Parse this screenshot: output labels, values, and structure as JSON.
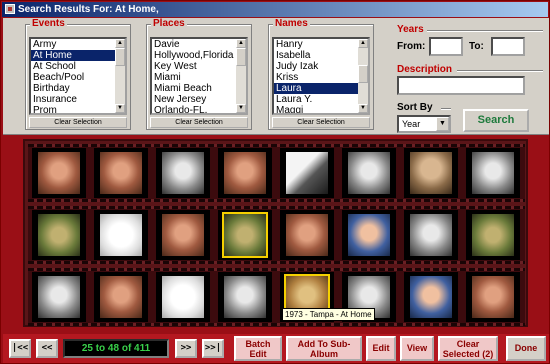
{
  "window": {
    "title": "Search Results For: At Home,"
  },
  "events": {
    "label": "Events",
    "items": [
      "Army",
      "At Home",
      "At School",
      "Beach/Pool",
      "Birthday",
      "Insurance",
      "Prom"
    ],
    "selected_index": 1,
    "clear_label": "Clear Selection"
  },
  "places": {
    "label": "Places",
    "items": [
      "Davie",
      "Hollywood,Florida",
      "Key West",
      "Miami",
      "Miami Beach",
      "New Jersey",
      "Orlando-FL."
    ],
    "selected_index": -1,
    "clear_label": "Clear Selection"
  },
  "names": {
    "label": "Names",
    "items": [
      "Hanry",
      "Isabella",
      "Judy Izak",
      "Kriss",
      "Laura",
      "Laura Y.",
      "Maggi"
    ],
    "selected_index": 4,
    "clear_label": "Clear Selection"
  },
  "years": {
    "label": "Years",
    "from_label": "From:",
    "to_label": "To:",
    "from_value": "",
    "to_value": ""
  },
  "description": {
    "label": "Description",
    "value": ""
  },
  "sort": {
    "label": "Sort By",
    "value": "Year"
  },
  "search_label": "Search",
  "photos": {
    "rows": [
      [
        "p-warm",
        "p-warm",
        "p-grey",
        "p-warm",
        "p-bw",
        "p-grey",
        "p-sepia",
        "p-grey"
      ],
      [
        "p-green",
        "p-light",
        "p-warm",
        "p-green",
        "p-warm",
        "p-blue",
        "p-grey",
        "p-green"
      ],
      [
        "p-grey",
        "p-warm",
        "p-light",
        "p-grey",
        "p-gold",
        "p-grey",
        "p-blue",
        "p-warm"
      ]
    ],
    "selected": [
      [
        1,
        3
      ],
      [
        2,
        4
      ]
    ],
    "tooltip": "1973 - Tampa - At Home"
  },
  "nav": {
    "first": "|<<",
    "prev": "<<",
    "next": ">>",
    "last": ">>|",
    "counter": "25 to 48 of 411"
  },
  "actions": {
    "batch_edit": "Batch Edit",
    "add_to_sub_album": "Add To Sub-Album",
    "edit": "Edit",
    "view": "View",
    "clear_selected": "Clear Selected (2)",
    "done": "Done"
  },
  "colors": {
    "frame_bg": "#9a0f16",
    "accent_red": "#c00000",
    "search_green": "#1e7a3c",
    "selection_blue": "#0a246a",
    "counter_green": "#39d04a",
    "selection_outline": "#f5d000"
  }
}
